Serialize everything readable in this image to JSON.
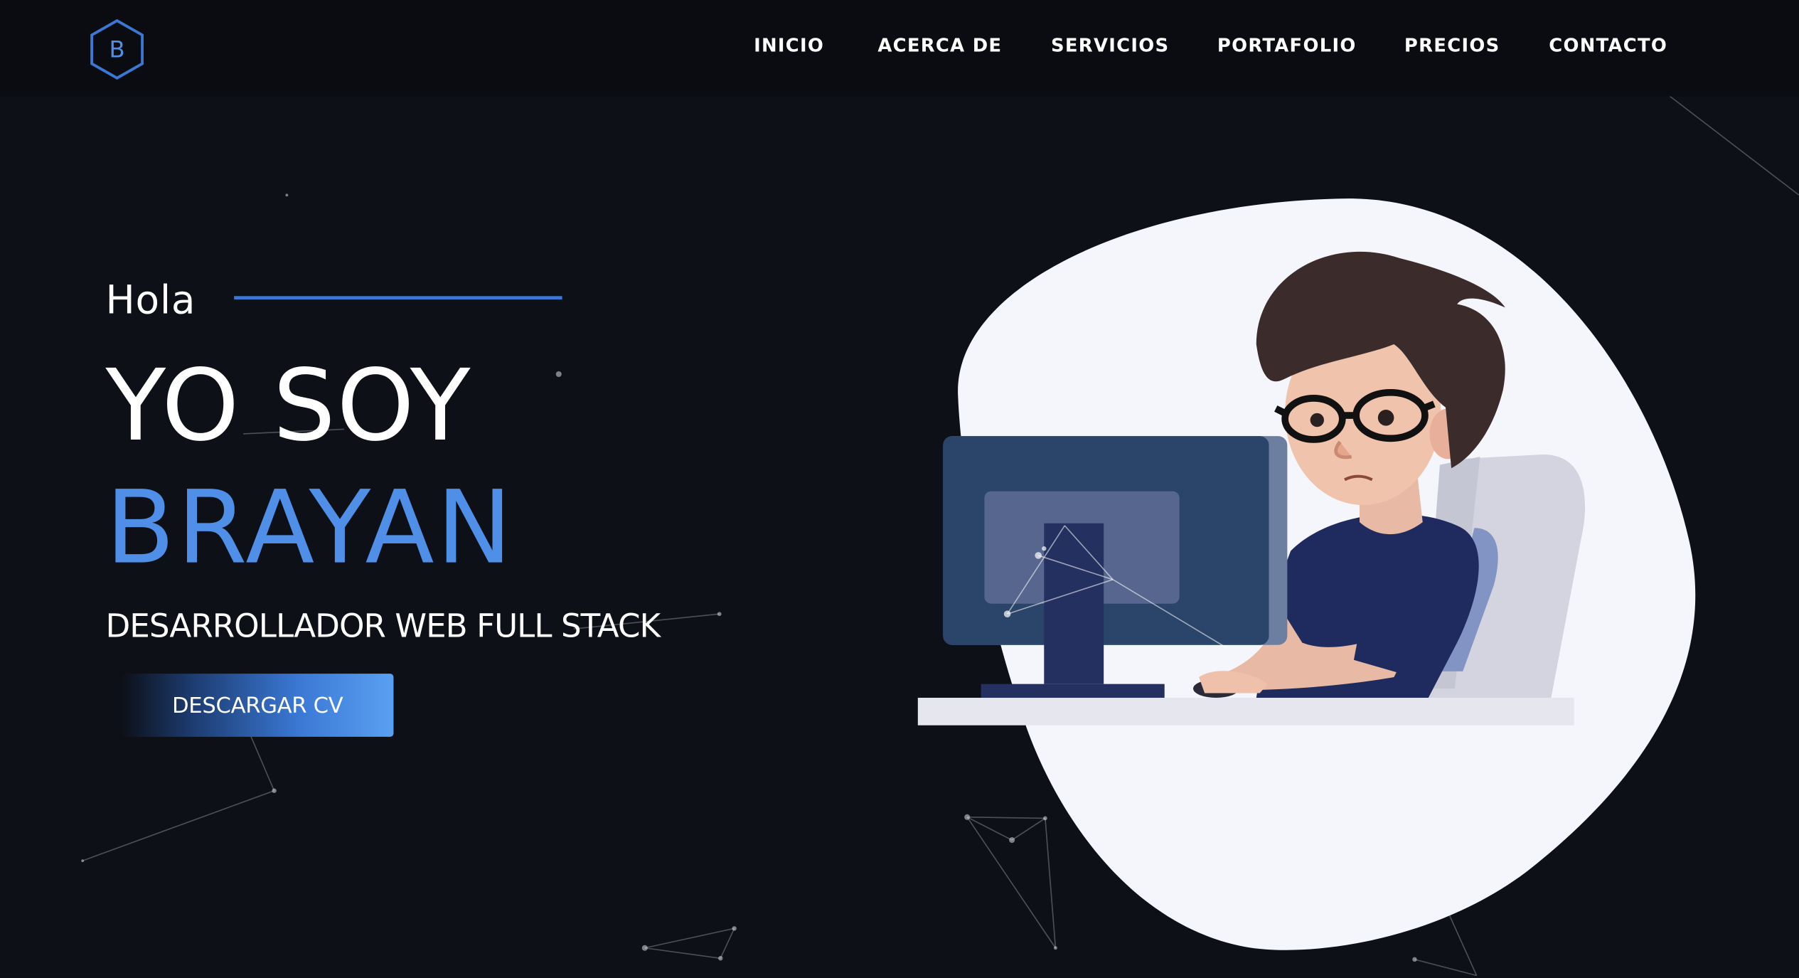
{
  "brand": {
    "logo_letter": "B",
    "logo_icon": "hexagon-logo-icon",
    "accent_color": "#4f8fe8"
  },
  "nav": {
    "items": [
      {
        "label": "INICIO"
      },
      {
        "label": "ACERCA DE"
      },
      {
        "label": "SERVICIOS"
      },
      {
        "label": "PORTAFOLIO"
      },
      {
        "label": "PRECIOS"
      },
      {
        "label": "CONTACTO"
      }
    ]
  },
  "hero": {
    "greeting": "Hola",
    "intro": "YO SOY",
    "name": "BRAYAN",
    "role": "DESARROLLADOR WEB FULL STACK",
    "cta_label": "DESCARGAR CV"
  },
  "colors": {
    "background": "#0d1017",
    "navbar": "#0a0c11",
    "accent": "#4f8fe8",
    "blob": "#f5f6fb"
  }
}
